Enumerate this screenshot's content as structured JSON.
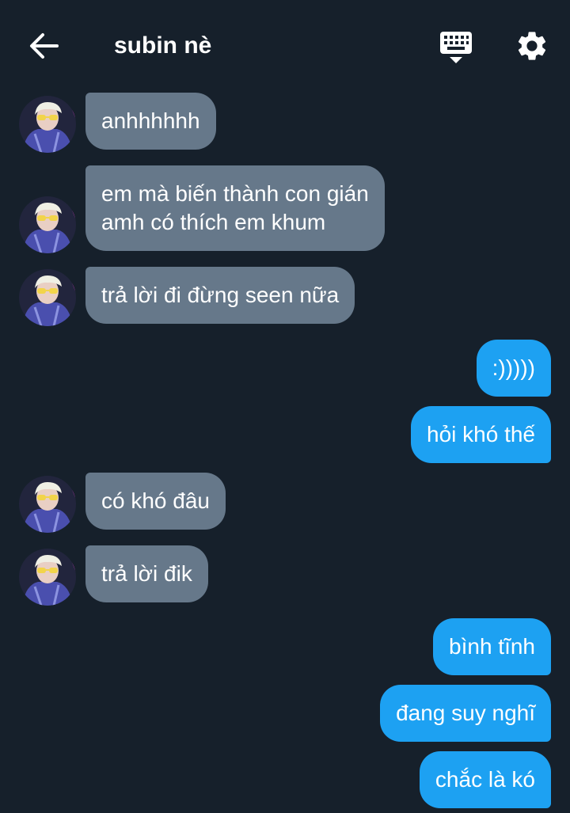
{
  "header": {
    "title": "subin nè",
    "back_icon": "arrow-left-icon",
    "keyboard_icon": "keyboard-icon",
    "settings_icon": "gear-icon"
  },
  "colors": {
    "background": "#16202b",
    "incoming_bubble": "#66788a",
    "outgoing_bubble": "#1da1f2",
    "text": "#ffffff"
  },
  "messages": [
    {
      "side": "in",
      "text": "anhhhhhh"
    },
    {
      "side": "in",
      "text": "em mà biến thành con gián\namh có thích em khum"
    },
    {
      "side": "in",
      "text": "trả lời đi đừng seen nữa"
    },
    {
      "side": "out",
      "text": ":)))))"
    },
    {
      "side": "out",
      "text": "hỏi khó thế"
    },
    {
      "side": "in",
      "text": "có khó đâu"
    },
    {
      "side": "in",
      "text": "trả lời đik"
    },
    {
      "side": "out",
      "text": "bình tĩnh"
    },
    {
      "side": "out",
      "text": "đang suy nghĩ"
    },
    {
      "side": "out",
      "text": "chắc là kó"
    }
  ]
}
